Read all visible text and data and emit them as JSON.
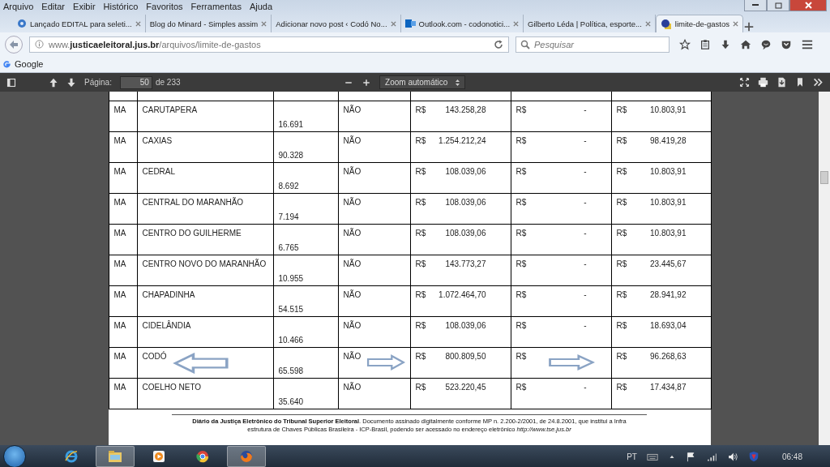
{
  "menu": [
    "Arquivo",
    "Editar",
    "Exibir",
    "Histórico",
    "Favoritos",
    "Ferramentas",
    "Ajuda"
  ],
  "tabs": [
    {
      "title": "Lançado EDITAL para seleti...",
      "selected": false,
      "kind": "globe"
    },
    {
      "title": "Blog do Minard - Simples assim",
      "selected": false,
      "kind": "none"
    },
    {
      "title": "Adicionar novo post ‹ Codó No...",
      "selected": false,
      "kind": "none"
    },
    {
      "title": "Outlook.com - codonotici...",
      "selected": false,
      "kind": "mail"
    },
    {
      "title": "Gilberto Léda | Política, esporte...",
      "selected": false,
      "kind": "none"
    },
    {
      "title": "limite-de-gastos",
      "selected": true,
      "kind": "sphere"
    }
  ],
  "address": {
    "url": "www.**justicaeleitoral.jus.br**/arquivos/limite-de-gastos"
  },
  "search": {
    "placeholder": "Pesquisar"
  },
  "bookmarks": [
    "Google"
  ],
  "pdf_toolbar": {
    "page_label": "Página:",
    "page": "50",
    "page_count": "de 233",
    "zoom": "Zoom automático"
  },
  "table": {
    "rows": [
      {
        "uf": "MA",
        "name": "CARUTAPERA",
        "number": "16.691",
        "flag": "NÃO",
        "currency_1": "R$",
        "amount_1": "143.258,28",
        "currency_2": "R$",
        "amount_2": "-",
        "currency_3": "R$",
        "amount_3": "10.803,91",
        "arrows": false
      },
      {
        "uf": "MA",
        "name": "CAXIAS",
        "number": "90.328",
        "flag": "NÃO",
        "currency_1": "R$",
        "amount_1": "1.254.212,24",
        "currency_2": "R$",
        "amount_2": "-",
        "currency_3": "R$",
        "amount_3": "98.419,28",
        "arrows": false
      },
      {
        "uf": "MA",
        "name": "CEDRAL",
        "number": "8.692",
        "flag": "NÃO",
        "currency_1": "R$",
        "amount_1": "108.039,06",
        "currency_2": "R$",
        "amount_2": "-",
        "currency_3": "R$",
        "amount_3": "10.803,91",
        "arrows": false
      },
      {
        "uf": "MA",
        "name": "CENTRAL DO MARANHÃO",
        "number": "7.194",
        "flag": "NÃO",
        "currency_1": "R$",
        "amount_1": "108.039,06",
        "currency_2": "R$",
        "amount_2": "-",
        "currency_3": "R$",
        "amount_3": "10.803,91",
        "arrows": false
      },
      {
        "uf": "MA",
        "name": "CENTRO DO GUILHERME",
        "number": "6.765",
        "flag": "NÃO",
        "currency_1": "R$",
        "amount_1": "108.039,06",
        "currency_2": "R$",
        "amount_2": "-",
        "currency_3": "R$",
        "amount_3": "10.803,91",
        "arrows": false
      },
      {
        "uf": "MA",
        "name": "CENTRO NOVO DO MARANHÃO",
        "number": "10.955",
        "flag": "NÃO",
        "currency_1": "R$",
        "amount_1": "143.773,27",
        "currency_2": "R$",
        "amount_2": "-",
        "currency_3": "R$",
        "amount_3": "23.445,67",
        "arrows": false
      },
      {
        "uf": "MA",
        "name": "CHAPADINHA",
        "number": "54.515",
        "flag": "NÃO",
        "currency_1": "R$",
        "amount_1": "1.072.464,70",
        "currency_2": "R$",
        "amount_2": "-",
        "currency_3": "R$",
        "amount_3": "28.941,92",
        "arrows": false
      },
      {
        "uf": "MA",
        "name": "CIDELÂNDIA",
        "number": "10.466",
        "flag": "NÃO",
        "currency_1": "R$",
        "amount_1": "108.039,06",
        "currency_2": "R$",
        "amount_2": "-",
        "currency_3": "R$",
        "amount_3": "18.693,04",
        "arrows": false
      },
      {
        "uf": "MA",
        "name": "CODÓ",
        "number": "65.598",
        "flag": "NÃO",
        "currency_1": "R$",
        "amount_1": "800.809,50",
        "currency_2": "R$",
        "currency_3": "R$",
        "amount_3": "96.268,63",
        "arrows": true
      },
      {
        "uf": "MA",
        "name": "COELHO NETO",
        "number": "35.640",
        "flag": "NÃO",
        "currency_1": "R$",
        "amount_1": "523.220,45",
        "currency_2": "R$",
        "amount_2": "-",
        "currency_3": "R$",
        "amount_3": "17.434,87",
        "arrows": false
      }
    ]
  },
  "footer": "**Diário da Justiça Eletrônico do Tribunal Superior Eleitoral**. Documento assinado digitalmente conforme MP n. 2.200-2/2001, de 24.8.2001, que institui a Infra estrutura de Chaves Públicas Brasileira - ICP-Brasil, podendo ser acessado no endereço eletrônico *http://www.tse.jus.br*",
  "taskbar": {
    "apps": [
      {
        "kind": "ie",
        "running": false
      },
      {
        "kind": "folder",
        "running": true
      },
      {
        "kind": "media",
        "running": false
      },
      {
        "kind": "chrome",
        "running": false
      },
      {
        "kind": "firefox",
        "running": true
      }
    ],
    "language": "PT",
    "time": "06:48"
  }
}
